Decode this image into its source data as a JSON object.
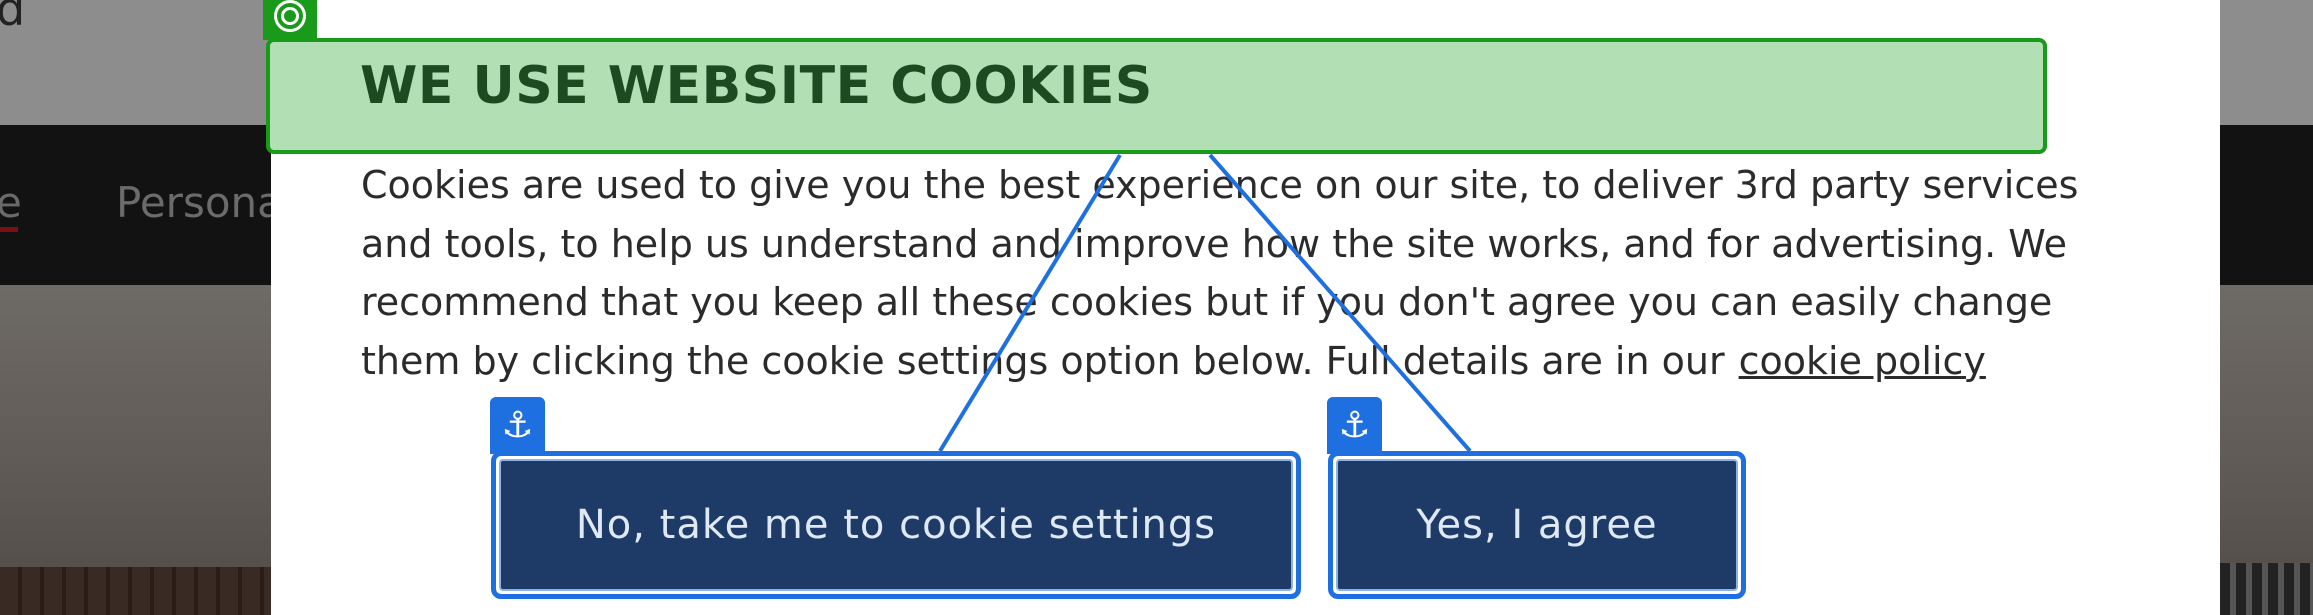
{
  "background": {
    "header_fragment": "d",
    "nav_items": [
      "e",
      "Persona"
    ]
  },
  "modal": {
    "title": "WE USE WEBSITE COOKIES",
    "body": "Cookies are used to give you the best experience on our site, to deliver 3rd party services and tools, to help us understand and improve how the site works, and for advertising. We recommend that you keep all these cookies but if you don't agree you can easily change them by clicking the cookie settings option below. Full details are in our",
    "policy_link": "cookie policy",
    "buttons": {
      "settings_label": "No, take me to cookie settings",
      "agree_label": "Yes, I agree"
    }
  },
  "annotations": {
    "title_icon": "target-icon",
    "button_icon": "anchor-icon",
    "anchor_glyph": "⚓",
    "colors": {
      "title_highlight": "#b3dfb5",
      "title_border": "#1a9a1a",
      "button_outline": "#1e6fe0",
      "button_fill": "#1e3a66"
    }
  }
}
